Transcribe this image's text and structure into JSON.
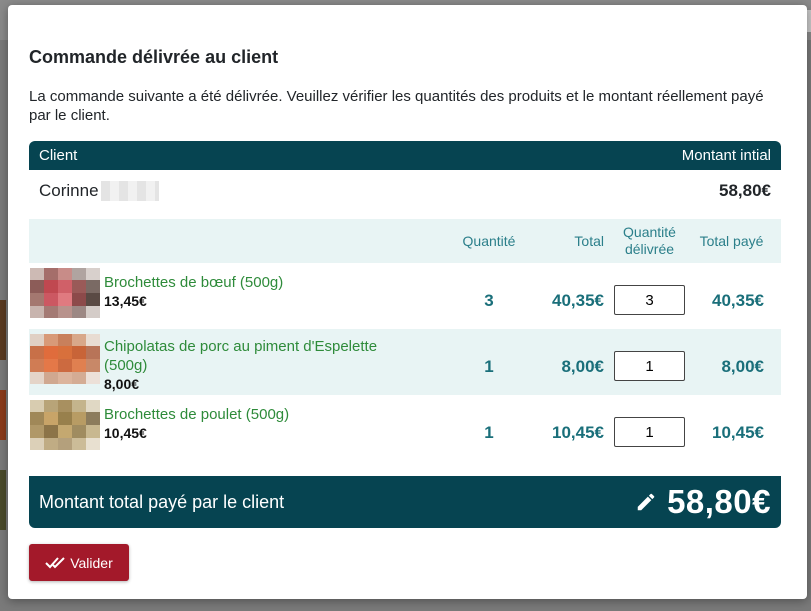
{
  "modal": {
    "title": "Commande délivrée au client",
    "description": "La commande suivante a été délivrée. Veuillez vérifier les quantités des produits et le montant réellement payé par le client."
  },
  "client": {
    "header_label": "Client",
    "header_amount_label": "Montant intial",
    "name": "Corinne",
    "amount": "58,80€"
  },
  "table": {
    "headers": {
      "quantity": "Quantité",
      "total": "Total",
      "delivered_quantity_line1": "Quantité",
      "delivered_quantity_line2": "délivrée",
      "total_paid": "Total payé"
    },
    "rows": [
      {
        "name": "Brochettes de bœuf (500g)",
        "price": "13,45€",
        "quantity": "3",
        "total": "40,35€",
        "delivered": "3",
        "paid": "40,35€"
      },
      {
        "name": "Chipolatas de porc au piment d'Espelette (500g)",
        "price": "8,00€",
        "quantity": "1",
        "total": "8,00€",
        "delivered": "1",
        "paid": "8,00€"
      },
      {
        "name": "Brochettes de poulet (500g)",
        "price": "10,45€",
        "quantity": "1",
        "total": "10,45€",
        "delivered": "1",
        "paid": "10,45€"
      }
    ]
  },
  "footer": {
    "total_label": "Montant total payé par le client",
    "total_amount": "58,80€",
    "validate_label": "Valider",
    "pencil_icon": "pencil-icon",
    "check_icon": "double-check-icon"
  },
  "colors": {
    "header_bg": "#064451",
    "row_alt_bg": "#e8f4f4",
    "product_name": "#2e8b3a",
    "value_teal": "#1a6f7a",
    "validate_bg": "#a3192a"
  }
}
